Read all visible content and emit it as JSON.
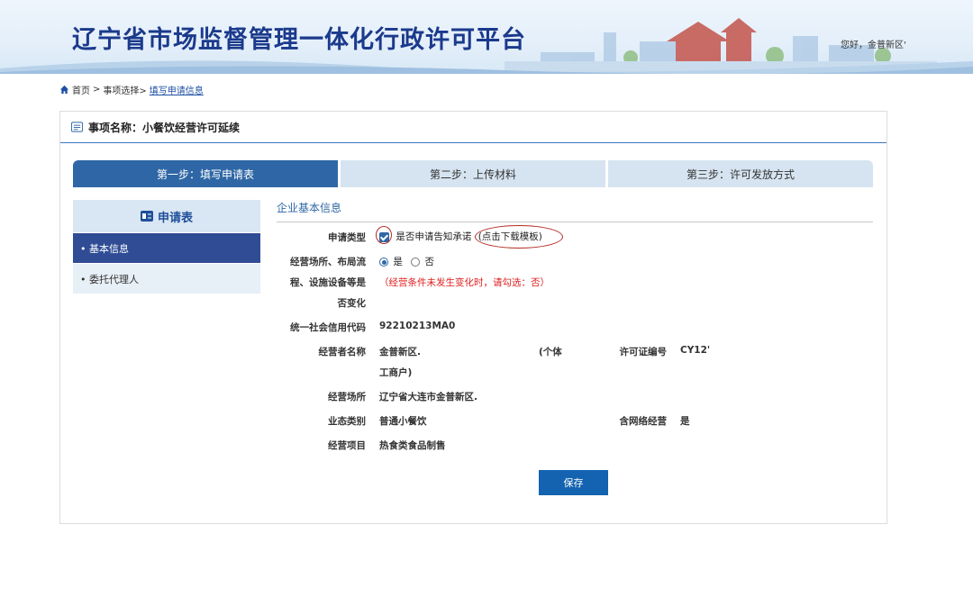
{
  "header": {
    "title": "辽宁省市场监督管理一体化行政许可平台",
    "greeting": "您好，金普新区'"
  },
  "breadcrumb": {
    "home": "首页",
    "sep1": ">",
    "step_select": "事项选择>",
    "current": "填写申请信息"
  },
  "panel": {
    "title": "事项名称：小餐饮经营许可延续"
  },
  "steps": [
    {
      "label": "第一步：填写申请表",
      "active": true
    },
    {
      "label": "第二步：上传材料",
      "active": false
    },
    {
      "label": "第三步：许可发放方式",
      "active": false
    }
  ],
  "menu": {
    "title": "申请表",
    "items": [
      {
        "label": "• 基本信息",
        "active": true
      },
      {
        "label": "• 委托代理人",
        "active": false
      }
    ]
  },
  "form": {
    "section_title": "企业基本信息",
    "apply_type_label": "申请类型",
    "apply_type_checkbox_label": "是否申请告知承诺",
    "download_template_link": "(点击下载模板)",
    "change_label_line1": "经营场所、布局流",
    "change_label_line2": "程、设施设备等是",
    "change_label_line3": "否变化",
    "radio_yes": "是",
    "radio_no": "否",
    "change_note": "（经营条件未发生变化时，请勾选：否）",
    "credit_code_label": "统一社会信用代码",
    "credit_code_value": "92210213MA0",
    "operator_name_label": "经营者名称",
    "operator_name_value": "金普新区.",
    "operator_name_suffix": "(个体",
    "operator_name_suffix2": "工商户)",
    "license_no_label": "许可证编号",
    "license_no_value": "CY12'",
    "address_label": "经营场所",
    "address_value": "辽宁省大连市金普新区.",
    "business_type_label": "业态类别",
    "business_type_value": "普通小餐饮",
    "online_label": "含网络经营",
    "online_value": "是",
    "items_label": "经营项目",
    "items_value": "热食类食品制售",
    "save_button": "保存"
  },
  "colors": {
    "brand_blue": "#2f67a6",
    "title_blue": "#1b3a8c",
    "warning_red": "#e02020",
    "menu_active": "#2f4c95"
  }
}
